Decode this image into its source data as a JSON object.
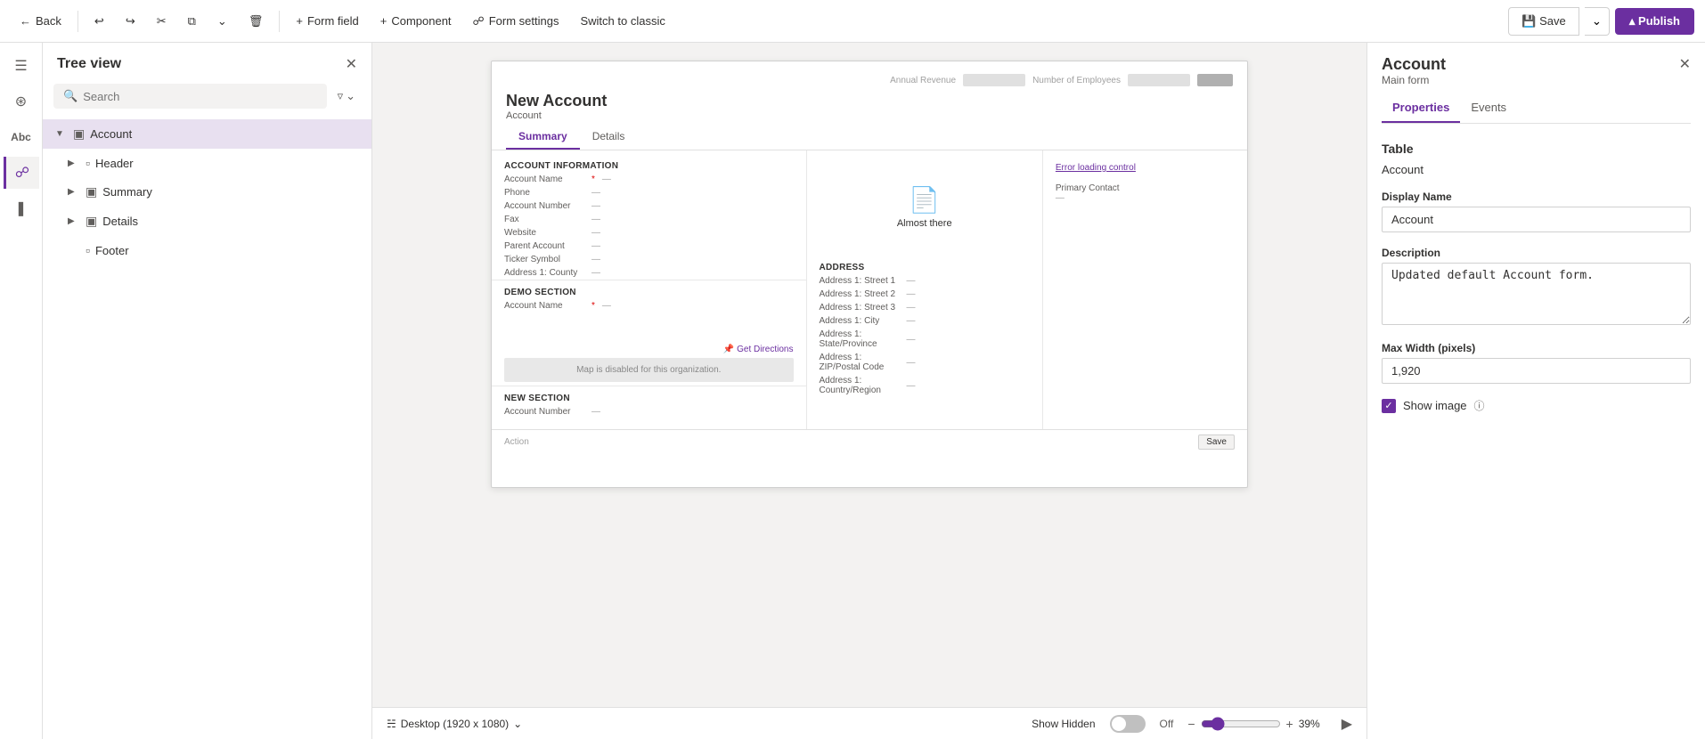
{
  "toolbar": {
    "back_label": "Back",
    "form_field_label": "Form field",
    "component_label": "Component",
    "form_settings_label": "Form settings",
    "switch_label": "Switch to classic",
    "save_label": "Save",
    "publish_label": "Publish"
  },
  "tree_view": {
    "title": "Tree view",
    "search_placeholder": "Search",
    "items": [
      {
        "label": "Account",
        "level": 0,
        "type": "table",
        "expanded": true
      },
      {
        "label": "Header",
        "level": 1,
        "type": "section"
      },
      {
        "label": "Summary",
        "level": 1,
        "type": "table",
        "expanded": true
      },
      {
        "label": "Details",
        "level": 1,
        "type": "table"
      },
      {
        "label": "Footer",
        "level": 1,
        "type": "section"
      }
    ]
  },
  "form_preview": {
    "title": "New Account",
    "subtitle": "Account",
    "topbar_label1": "Annual Revenue",
    "topbar_label2": "Number of Employees",
    "tabs": [
      "Summary",
      "Details"
    ],
    "active_tab": "Summary",
    "section1_title": "ACCOUNT INFORMATION",
    "fields_left": [
      {
        "label": "Account Name",
        "required": true,
        "value": "—"
      },
      {
        "label": "Phone",
        "required": false,
        "value": "—"
      },
      {
        "label": "Account Number",
        "required": false,
        "value": "—"
      },
      {
        "label": "Fax",
        "required": false,
        "value": "—"
      },
      {
        "label": "Website",
        "required": false,
        "value": "—"
      },
      {
        "label": "Parent Account",
        "required": false,
        "value": "—"
      },
      {
        "label": "Ticker Symbol",
        "required": false,
        "value": "—"
      },
      {
        "label": "Address 1: County",
        "required": false,
        "value": "—"
      }
    ],
    "timeline_text": "Almost there",
    "error_link": "Error loading control",
    "primary_contact_label": "Primary Contact",
    "address_section_title": "ADDRESS",
    "address_fields": [
      {
        "label": "Address 1: Street 1",
        "value": "—"
      },
      {
        "label": "Address 1: Street 2",
        "value": "—"
      },
      {
        "label": "Address 1: Street 3",
        "value": "—"
      },
      {
        "label": "Address 1: City",
        "value": "—"
      },
      {
        "label": "Address 1: State/Province",
        "value": "—"
      },
      {
        "label": "Address 1: ZIP/Postal Code",
        "value": "—"
      },
      {
        "label": "Address 1: Country/Region",
        "value": "—"
      }
    ],
    "get_directions": "Get Directions",
    "map_disabled": "Map is disabled for this organization.",
    "demo_section": "Demo Section",
    "demo_fields": [
      {
        "label": "Account Name",
        "required": true,
        "value": "—"
      }
    ],
    "new_section": "New Section",
    "new_section_fields": [
      {
        "label": "Account Number",
        "value": "—"
      }
    ],
    "footer_left": "Action",
    "footer_right": "Save"
  },
  "bottom_bar": {
    "desktop_label": "Desktop (1920 x 1080)",
    "show_hidden_label": "Show Hidden",
    "toggle_state": "Off",
    "zoom_pct": "39%"
  },
  "right_panel": {
    "title": "Account",
    "subtitle": "Main form",
    "tabs": [
      "Properties",
      "Events"
    ],
    "active_tab": "Properties",
    "section_table_label": "Table",
    "table_name": "Account",
    "display_name_label": "Display Name",
    "display_name_value": "Account",
    "description_label": "Description",
    "description_value": "Updated default Account form.",
    "max_width_label": "Max Width (pixels)",
    "max_width_value": "1,920",
    "show_image_label": "Show image",
    "show_image_checked": true
  }
}
